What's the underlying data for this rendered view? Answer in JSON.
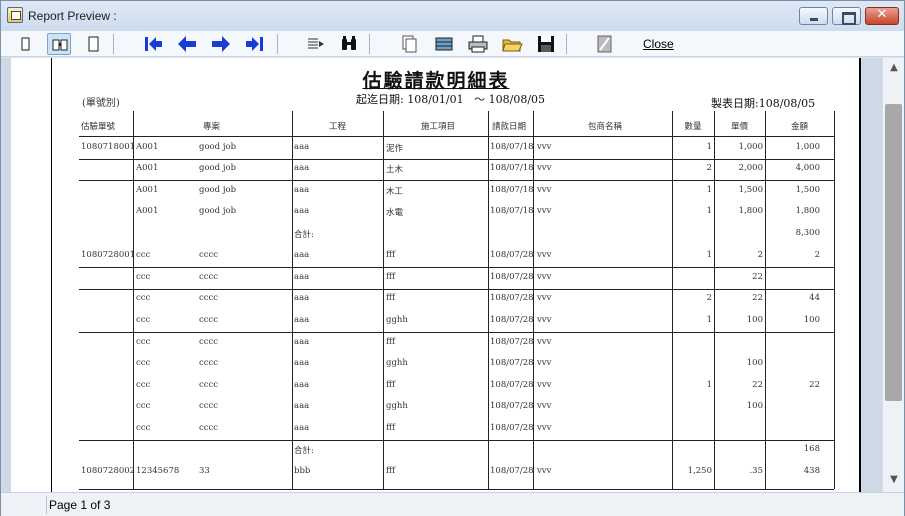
{
  "window": {
    "title": "Report Preview :"
  },
  "toolbar": {
    "close_label": "Close",
    "icons": [
      "single-page-icon",
      "facing-pages-icon",
      "fit-page-icon",
      "first-page-icon",
      "prev-page-icon",
      "next-page-icon",
      "last-page-icon",
      "goto-page-icon",
      "find-icon",
      "copy-icon",
      "export-icon",
      "print-icon",
      "open-icon",
      "save-icon",
      "page-setup-icon"
    ]
  },
  "report": {
    "title": "估驗請款明細表",
    "date_range_label": "起迄日期:",
    "date_from": "108/01/01",
    "date_sep": "～",
    "date_to": "108/08/05",
    "group_label": "(單號別)",
    "made_date_label": "製表日期:",
    "made_date": "108/08/05",
    "headers": [
      "估驗單號",
      "專案",
      "工程",
      "施工項目",
      "請款日期",
      "包商名稱",
      "數量",
      "單價",
      "金額"
    ],
    "rows": [
      [
        "1080718001",
        "A001",
        "good job",
        "aaa",
        "泥作",
        "108/07/18",
        "vvv",
        "1",
        "1,000",
        "1,000"
      ],
      [
        "",
        "A001",
        "good job",
        "aaa",
        "土木",
        "108/07/18",
        "vvv",
        "2",
        "2,000",
        "4,000"
      ],
      [
        "",
        "A001",
        "good job",
        "aaa",
        "木工",
        "108/07/18",
        "vvv",
        "1",
        "1,500",
        "1,500"
      ],
      [
        "",
        "A001",
        "good job",
        "aaa",
        "水電",
        "108/07/18",
        "vvv",
        "1",
        "1,800",
        "1,800"
      ],
      [
        "",
        "",
        "",
        "合計:",
        "",
        "",
        "",
        "",
        "",
        "8,300"
      ],
      [
        "1080728001",
        "ccc",
        "cccc",
        "aaa",
        "fff",
        "108/07/28",
        "vvv",
        "1",
        "2",
        "2"
      ],
      [
        "",
        "ccc",
        "cccc",
        "aaa",
        "fff",
        "108/07/28",
        "vvv",
        "",
        "22",
        ""
      ],
      [
        "",
        "ccc",
        "cccc",
        "aaa",
        "fff",
        "108/07/28",
        "vvv",
        "2",
        "22",
        "44"
      ],
      [
        "",
        "ccc",
        "cccc",
        "aaa",
        "gghh",
        "108/07/28",
        "vvv",
        "1",
        "100",
        "100"
      ],
      [
        "",
        "ccc",
        "cccc",
        "aaa",
        "fff",
        "108/07/28",
        "vvv",
        "",
        "",
        ""
      ],
      [
        "",
        "ccc",
        "cccc",
        "aaa",
        "gghh",
        "108/07/28",
        "vvv",
        "",
        "100",
        ""
      ],
      [
        "",
        "ccc",
        "cccc",
        "aaa",
        "fff",
        "108/07/28",
        "vvv",
        "1",
        "22",
        "22"
      ],
      [
        "",
        "ccc",
        "cccc",
        "aaa",
        "gghh",
        "108/07/28",
        "vvv",
        "",
        "100",
        ""
      ],
      [
        "",
        "ccc",
        "cccc",
        "aaa",
        "fff",
        "108/07/28",
        "vvv",
        "",
        "",
        ""
      ],
      [
        "",
        "",
        "",
        "合計:",
        "",
        "",
        "",
        "",
        "",
        "168"
      ],
      [
        "1080728002",
        "12345678",
        "33",
        "bbb",
        "fff",
        "108/07/28",
        "vvv",
        "1,250",
        ".35",
        "438"
      ]
    ]
  },
  "status": {
    "page_text": "Page 1 of 3"
  }
}
